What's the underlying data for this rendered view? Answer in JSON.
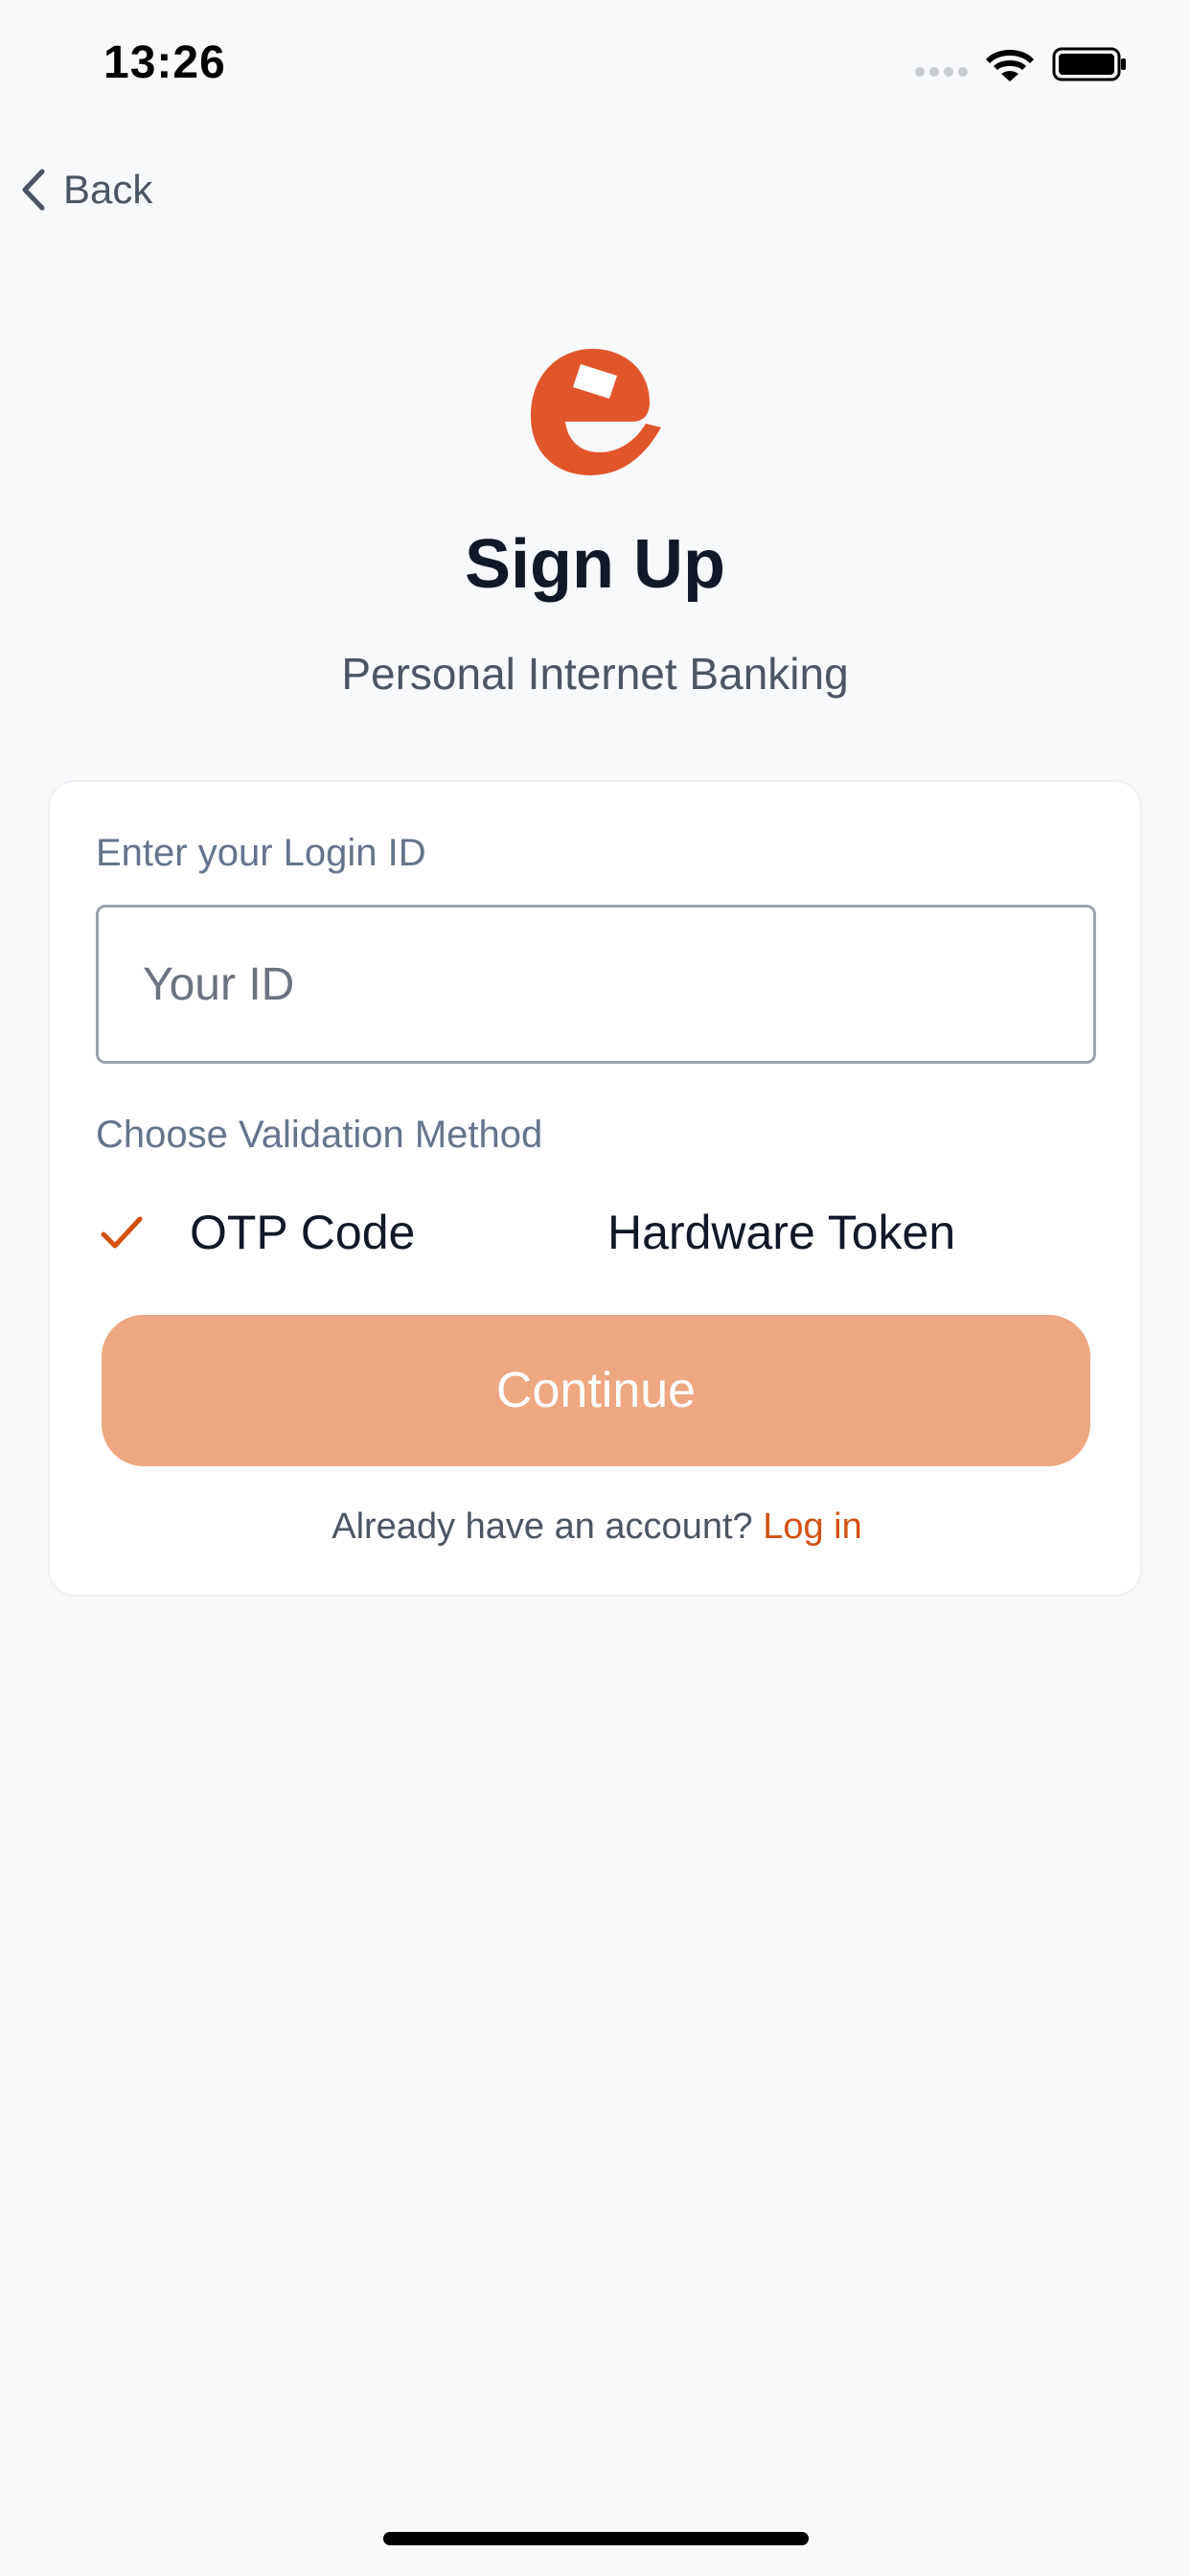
{
  "status_bar": {
    "time": "13:26",
    "icons": [
      "signal-dots-icon",
      "wifi-icon",
      "battery-icon"
    ]
  },
  "nav": {
    "back_label": "Back",
    "back_icon": "chevron-left-icon"
  },
  "header": {
    "logo_icon": "brand-e-logo-icon",
    "title": "Sign Up",
    "subtitle": "Personal Internet Banking"
  },
  "form": {
    "login_label": "Enter your Login ID",
    "login_placeholder": "Your ID",
    "login_value": "",
    "method_label": "Choose Validation Method",
    "methods": [
      {
        "label": "OTP Code",
        "selected": true
      },
      {
        "label": "Hardware Token",
        "selected": false
      }
    ],
    "continue_label": "Continue",
    "account_prompt": "Already have an account?",
    "login_link": "Log in"
  },
  "colors": {
    "accent": "#d4500f",
    "logo": "#e0562a",
    "button_disabled": "#eda781",
    "background": "#f8f9fb",
    "card": "#ffffff",
    "text_primary": "#111827",
    "text_secondary": "#64748b"
  }
}
